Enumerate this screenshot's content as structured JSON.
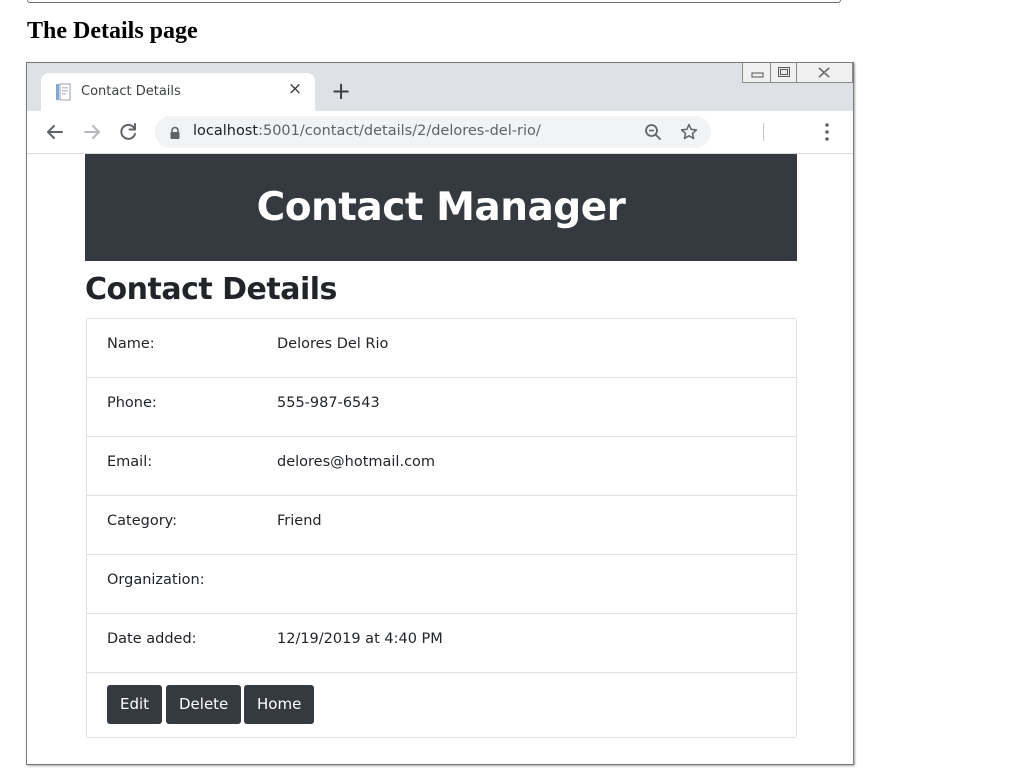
{
  "caption": "The Details page",
  "browser": {
    "tab_title": "Contact Details",
    "url_host": "localhost",
    "url_path": ":5001/contact/details/2/delores-del-rio/"
  },
  "site": {
    "banner_title": "Contact Manager",
    "page_heading": "Contact Details"
  },
  "details": {
    "rows": [
      {
        "label": "Name:",
        "value": "Delores Del Rio"
      },
      {
        "label": "Phone:",
        "value": "555-987-6543"
      },
      {
        "label": "Email:",
        "value": "delores@hotmail.com"
      },
      {
        "label": "Category:",
        "value": "Friend"
      },
      {
        "label": "Organization:",
        "value": ""
      },
      {
        "label": "Date added:",
        "value": "12/19/2019 at 4:40 PM"
      }
    ]
  },
  "actions": {
    "edit_label": "Edit",
    "delete_label": "Delete",
    "home_label": "Home"
  },
  "colors": {
    "banner_bg": "#343a40",
    "button_bg": "#343a40",
    "tabstrip_bg": "#dee1e6",
    "omnibox_bg": "#f1f3f4"
  }
}
